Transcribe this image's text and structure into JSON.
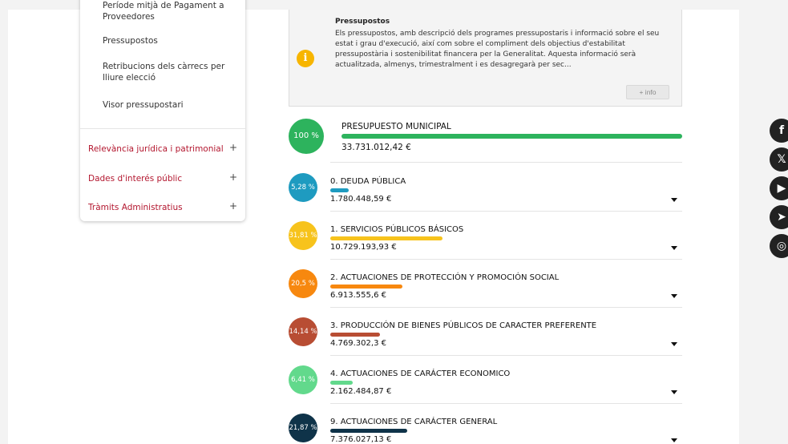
{
  "sidebar": {
    "submenu": [
      {
        "label": "Període mitjà de Pagament a Proveedores"
      },
      {
        "label": "Pressupostos"
      },
      {
        "label": "Retribucions dels càrrecs per lliure elecció"
      },
      {
        "label": "Visor pressupostari"
      }
    ],
    "sections": [
      {
        "label": "Relevància jurídica i patrimonial",
        "expand": "+"
      },
      {
        "label": "Dades d'interés públic",
        "expand": "+"
      },
      {
        "label": "Tràmits Administratius",
        "expand": "+"
      }
    ]
  },
  "info": {
    "title": "Pressupostos",
    "text": "Els pressupostos, amb descripció dels programes pressupostaris i informació sobre el seu estat i grau d'execució, així com sobre el compliment dels objectius d'estabilitat pressupostària i sostenibilitat financera per la Generalitat. Aquesta informació serà actualitzada, almenys, trimestralment i es desagregarà per sec...",
    "button": "+ info"
  },
  "budget": {
    "total": {
      "percent": "100 %",
      "label": "PRESUPUESTO MUNICIPAL",
      "amount": "33.731.012,42 €",
      "share": 100,
      "color": "#2db35d"
    },
    "items": [
      {
        "percent": "5,28 %",
        "label": "0. DEUDA PÚBLICA",
        "amount": "1.780.448,59 €",
        "share": 5.28,
        "color": "#1e9bc0"
      },
      {
        "percent": "31,81 %",
        "label": "1. SERVICIOS PÚBLICOS BÁSICOS",
        "amount": "10.729.193,93 €",
        "share": 31.81,
        "color": "#f7c31c"
      },
      {
        "percent": "20,5 %",
        "label": "2. ACTUACIONES DE PROTECCIÓN Y PROMOCIÓN SOCIAL",
        "amount": "6.913.555,6 €",
        "share": 20.5,
        "color": "#f7880f"
      },
      {
        "percent": "14,14 %",
        "label": "3. PRODUCCIÓN DE BIENES PÚBLICOS DE CARACTER PREFERENTE",
        "amount": "4.769.302,3 €",
        "share": 14.14,
        "color": "#b84d33"
      },
      {
        "percent": "6,41 %",
        "label": "4. ACTUACIONES DE CARÁCTER ECONOMICO",
        "amount": "2.162.484,87 €",
        "share": 6.41,
        "color": "#62d98c"
      },
      {
        "percent": "21,87 %",
        "label": "9. ACTUACIONES DE CARÁCTER GENERAL",
        "amount": "7.376.027,13 €",
        "share": 21.87,
        "color": "#0f3349"
      }
    ]
  },
  "social": [
    {
      "icon": "facebook-icon",
      "glyph": "f"
    },
    {
      "icon": "x-twitter-icon",
      "glyph": "𝕏"
    },
    {
      "icon": "youtube-icon",
      "glyph": "▶"
    },
    {
      "icon": "telegram-icon",
      "glyph": "➤"
    },
    {
      "icon": "instagram-icon",
      "glyph": "◎"
    }
  ]
}
